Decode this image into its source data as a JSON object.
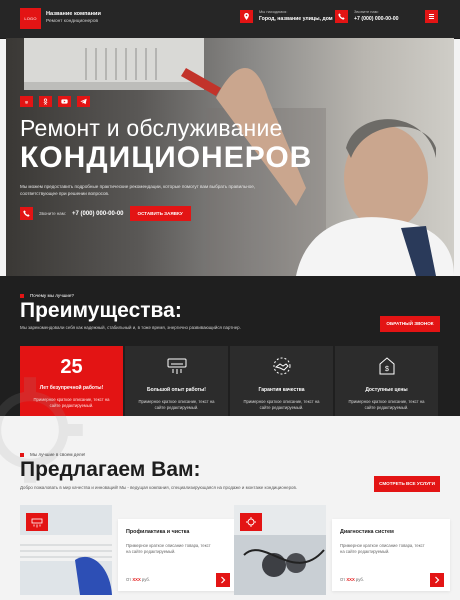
{
  "header": {
    "logo": "LOGO",
    "company_name": "Название компании",
    "company_tagline": "Ремонт кондиционеров",
    "address_caption": "Мы находимся:",
    "address": "Город, название улицы, дом",
    "phone_caption": "Звоните нам:",
    "phone": "+7 (000) 000-00-00"
  },
  "hero": {
    "social_icons": [
      "vk-icon",
      "ok-icon",
      "youtube-icon",
      "telegram-icon"
    ],
    "title_line1": "Ремонт и обслуживание",
    "title_line2": "КОНДИЦИОНЕРОВ",
    "description": "Мы можем предоставить подробные практические рекомендации, которые помогут вам выбрать правильное, соответствующее при решении вопросов.",
    "cta_caption": "Звоните нам:",
    "cta_phone": "+7 (000) 000-00-00",
    "cta_button": "ОСТАВИТЬ ЗАЯВКУ"
  },
  "advantages": {
    "eyebrow": "Почему мы лучшие?",
    "title": "Преимущества:",
    "subtitle": "Мы зарекомендовали себя как надежный, стабильный и, в тоже время, энергично развивающийся партнер.",
    "button": "ОБРАТНЫЙ ЗВОНОК",
    "cards": [
      {
        "number": "25",
        "title": "Лет безупречной работы!",
        "text": "Примерное краткое описание, текст на сайте редактируемый."
      },
      {
        "icon": "air-conditioner-icon",
        "title": "Большой опыт работы!",
        "text": "Примерное краткое описание, текст на сайте редактируемый."
      },
      {
        "icon": "handshake-icon",
        "title": "Гарантия качества",
        "text": "Примерное краткое описание, текст на сайте редактируемый."
      },
      {
        "icon": "price-tag-icon",
        "title": "Доступные цены",
        "text": "Примерное краткое описание, текст на сайте редактируемый."
      }
    ]
  },
  "offers": {
    "eyebrow": "Мы лучшие в своем деле!",
    "title": "Предлагаем Вам:",
    "subtitle": "Добро пожаловать в мир качества и инноваций! Мы - ведущая компания, специализирующаяся на продаже и монтаже кондиционеров.",
    "button": "СМОТРЕТЬ ВСЕ УСЛУГИ",
    "services": [
      {
        "title": "Профилактика и чистка",
        "text": "Примерное краткое описание товара, текст на сайте редактируемый.",
        "price_prefix": "От",
        "price_value": "XXX",
        "price_unit": "руб."
      },
      {
        "title": "Диагностика систем",
        "text": "Примерное краткое описание товара, текст на сайте редактируемый.",
        "price_prefix": "От",
        "price_value": "XXX",
        "price_unit": "руб."
      }
    ]
  },
  "colors": {
    "accent": "#e31414",
    "dark": "#1f1f1f",
    "card": "#2c2c2c"
  }
}
